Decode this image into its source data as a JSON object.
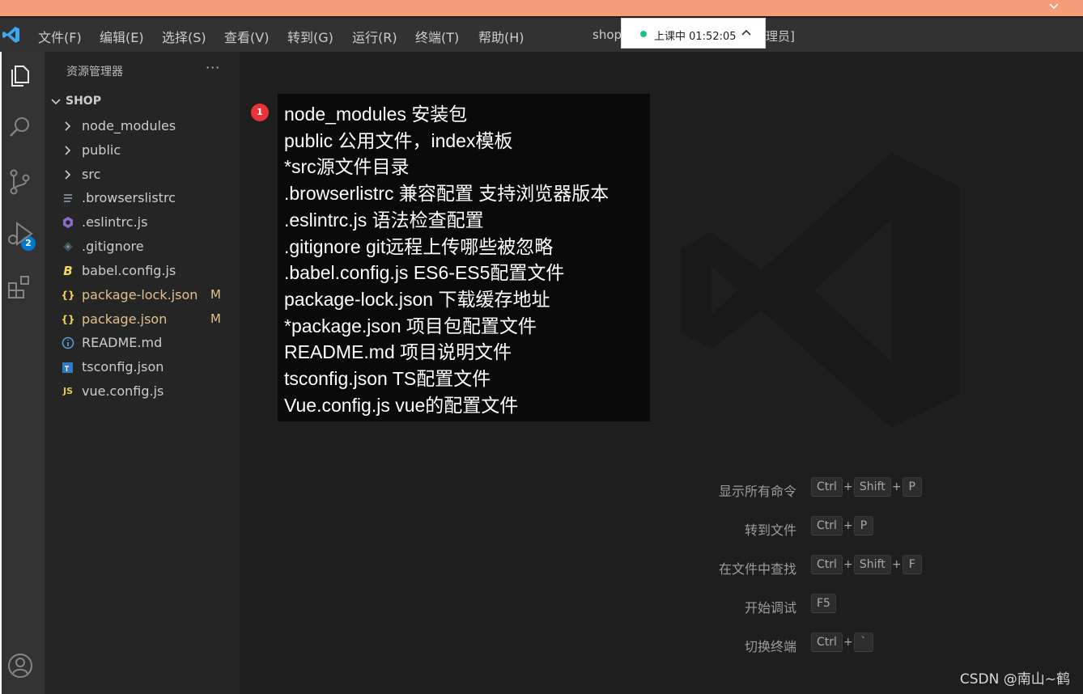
{
  "menubar": {
    "items": [
      "文件(F)",
      "编辑(E)",
      "选择(S)",
      "查看(V)",
      "转到(G)",
      "运行(R)",
      "终端(T)",
      "帮助(H)"
    ],
    "title_left": "shop",
    "title_right": "理员]"
  },
  "class_status": {
    "text": "上课中 01:52:05",
    "dot_color": "#21c08b"
  },
  "activity_bar": {
    "icons": [
      "files-icon",
      "search-icon",
      "source-control-icon",
      "run-debug-icon",
      "extensions-icon",
      "account-icon"
    ],
    "scm_badge": "2"
  },
  "explorer": {
    "title": "资源管理器",
    "more": "···",
    "folder": "SHOP",
    "items": [
      {
        "label": "node_modules",
        "kind": "folder",
        "status": ""
      },
      {
        "label": "public",
        "kind": "folder",
        "status": ""
      },
      {
        "label": "src",
        "kind": "folder",
        "status": ""
      },
      {
        "label": ".browserslistrc",
        "kind": "text",
        "status": ""
      },
      {
        "label": ".eslintrc.js",
        "kind": "eslint",
        "status": ""
      },
      {
        "label": ".gitignore",
        "kind": "git",
        "status": ""
      },
      {
        "label": "babel.config.js",
        "kind": "babel",
        "status": ""
      },
      {
        "label": "package-lock.json",
        "kind": "json",
        "status": "M"
      },
      {
        "label": "package.json",
        "kind": "json",
        "status": "M"
      },
      {
        "label": "README.md",
        "kind": "info",
        "status": ""
      },
      {
        "label": "tsconfig.json",
        "kind": "ts",
        "status": ""
      },
      {
        "label": "vue.config.js",
        "kind": "js",
        "status": ""
      }
    ]
  },
  "annotation": {
    "number": "1",
    "lines": [
      "node_modules 安装包",
      "public 公用文件，index模板",
      "*src源文件目录",
      ".browserlistrc 兼容配置 支持浏览器版本",
      ".eslintrc.js 语法检查配置",
      ".gitignore git远程上传哪些被忽略",
      ".babel.config.js ES6-ES5配置文件",
      "package-lock.json 下载缓存地址",
      "*package.json 项目包配置文件",
      "README.md 项目说明文件",
      "tsconfig.json TS配置文件",
      "Vue.config.js vue的配置文件"
    ]
  },
  "shortcuts": [
    {
      "command": "显示所有命令",
      "keys": [
        "Ctrl",
        "Shift",
        "P"
      ]
    },
    {
      "command": "转到文件",
      "keys": [
        "Ctrl",
        "P"
      ]
    },
    {
      "command": "在文件中查找",
      "keys": [
        "Ctrl",
        "Shift",
        "F"
      ]
    },
    {
      "command": "开始调试",
      "keys": [
        "F5"
      ]
    },
    {
      "command": "切换终端",
      "keys": [
        "Ctrl",
        "`"
      ]
    }
  ],
  "watermark": "CSDN @南山~鹤"
}
